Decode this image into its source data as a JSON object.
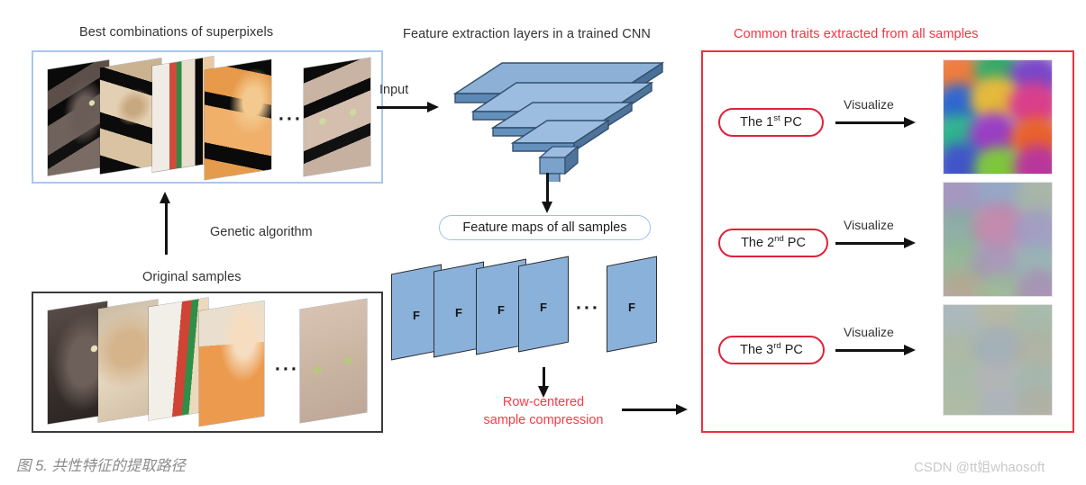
{
  "figure": {
    "caption": "图 5. 共性特征的提取路径",
    "watermark": "CSDN @tt姐whaosoft"
  },
  "colors": {
    "accent_red": "#ee2f3f",
    "title_red": "#f8323f",
    "panel_blue_border": "#a8c8ea",
    "panel_dark_border": "#3b3b3b",
    "cnn_blue": "#7ba7d3",
    "feature_map_blue": "#8ab1da",
    "caption_gray": "#8b8b8b",
    "watermark_gray": "#c9c9c9"
  },
  "left": {
    "superpixels_title": "Best combinations of superpixels",
    "superpixels_ellipsis": "···",
    "genetic_algorithm_label": "Genetic algorithm",
    "original_samples_title": "Original samples",
    "original_samples_ellipsis": "···"
  },
  "middle": {
    "cnn_title": "Feature extraction layers in a trained CNN",
    "input_label": "Input",
    "feature_maps_pill": "Feature maps of all samples",
    "feature_map_letter": "F",
    "feature_maps_ellipsis": "···",
    "compression_line1": "Row-centered",
    "compression_line2": "sample compression"
  },
  "right": {
    "title": "Common traits extracted from all samples",
    "rows": [
      {
        "pc_prefix": "The 1",
        "pc_ordinal": "st",
        "pc_suffix": " PC",
        "arrow_label": "Visualize"
      },
      {
        "pc_prefix": "The 2",
        "pc_ordinal": "nd",
        "pc_suffix": " PC",
        "arrow_label": "Visualize"
      },
      {
        "pc_prefix": "The 3",
        "pc_ordinal": "rd",
        "pc_suffix": " PC",
        "arrow_label": "Visualize"
      }
    ]
  }
}
